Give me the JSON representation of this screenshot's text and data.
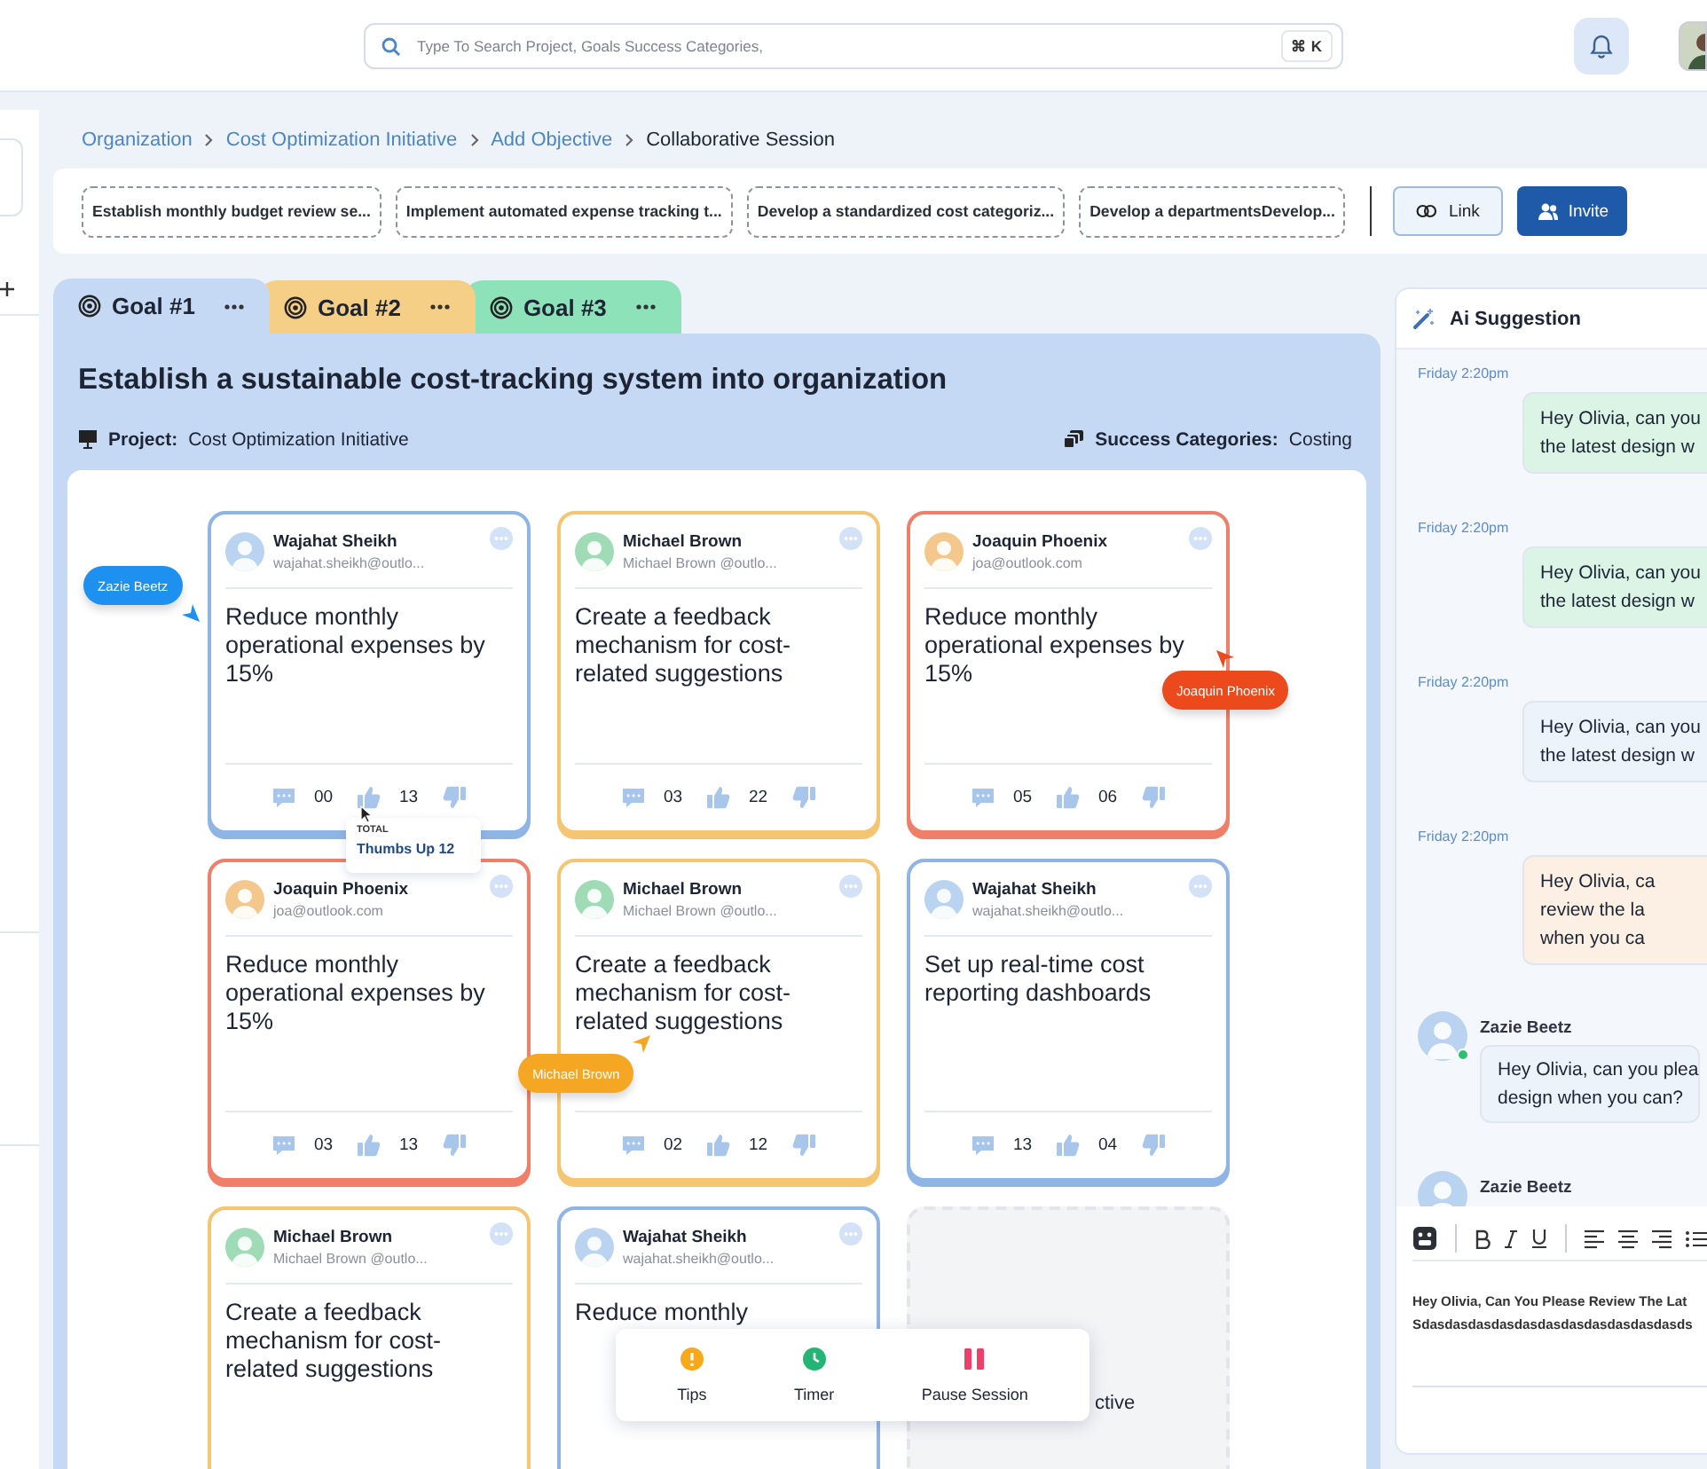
{
  "search": {
    "placeholder": "Type To Search Project, Goals Success Categories,",
    "shortcut": "⌘ K"
  },
  "breadcrumb": [
    {
      "label": "Organization",
      "current": false
    },
    {
      "label": "Cost Optimization Initiative",
      "current": false
    },
    {
      "label": "Add Objective",
      "current": false
    },
    {
      "label": "Collaborative Session",
      "current": true
    }
  ],
  "objective_chips": [
    "Establish monthly budget review se...",
    "Implement automated expense tracking t...",
    "Develop a standardized cost categoriz...",
    "Develop a  departmentsDevelop..."
  ],
  "actions": [
    {
      "label": "Link",
      "kind": "outline"
    },
    {
      "label": "Invite",
      "kind": "primary"
    }
  ],
  "goal_tabs": [
    {
      "label": "Goal #1",
      "color": "#c6d9f4",
      "selected": true
    },
    {
      "label": "Goal #2",
      "color": "#f6cf86",
      "selected": false
    },
    {
      "label": "Goal #3",
      "color": "#8ee2b9",
      "selected": false
    }
  ],
  "goal": {
    "title": "Establish a sustainable cost-tracking system into organization",
    "project_label": "Project:",
    "project": "Cost Optimization Initiative",
    "categories_label": "Success Categories:",
    "categories": "Costing"
  },
  "cards": [
    {
      "kind": "objective",
      "author": "Wajahat Sheikh",
      "email": "wajahat.sheikh@outlo...",
      "color": "#8fb5e6",
      "avatar": {
        "color": "#b9d3f0"
      },
      "text": "Reduce monthly operational expenses by 15%",
      "comments": "00",
      "likes": "13",
      "tooltip": {
        "title": "TOTAL",
        "text": "Thumbs Up 12"
      }
    },
    {
      "kind": "objective",
      "author": "Michael Brown",
      "email": "Michael Brown @outlo...",
      "color": "#f5c572",
      "avatar": {
        "color": "#9fdcb6"
      },
      "text": "Create a feedback mechanism for cost-related suggestions",
      "comments": "03",
      "likes": "22"
    },
    {
      "kind": "objective",
      "author": "Joaquin Phoenix",
      "email": "joa@outlook.com",
      "color": "#ef7f68",
      "avatar": {
        "color": "#f4c88c"
      },
      "text": "Reduce monthly operational expenses by 15%",
      "comments": "05",
      "likes": "06"
    },
    {
      "kind": "objective",
      "author": "Joaquin Phoenix",
      "email": "joa@outlook.com",
      "color": "#ef7f68",
      "avatar": {
        "color": "#f4c88c"
      },
      "text": "Reduce monthly operational expenses by 15%",
      "comments": "03",
      "likes": "13"
    },
    {
      "kind": "objective",
      "author": "Michael Brown",
      "email": "Michael Brown @outlo...",
      "color": "#f5c572",
      "avatar": {
        "color": "#9fdcb6"
      },
      "text": "Create a feedback mechanism for cost-related suggestions",
      "comments": "02",
      "likes": "12"
    },
    {
      "kind": "objective",
      "author": "Wajahat Sheikh",
      "email": "wajahat.sheikh@outlo...",
      "color": "#8fb5e6",
      "avatar": {
        "color": "#b9d3f0"
      },
      "text": "Set up real-time cost reporting dashboards",
      "comments": "13",
      "likes": "04"
    },
    {
      "kind": "objective",
      "author": "Michael Brown",
      "email": "Michael Brown @outlo...",
      "color": "#f5c572",
      "avatar": {
        "color": "#9fdcb6"
      },
      "text": "Create a feedback mechanism for cost-related suggestions"
    },
    {
      "kind": "objective",
      "author": "Wajahat Sheikh",
      "email": "wajahat.sheikh@outlo...",
      "color": "#8fb5e6",
      "avatar": {
        "color": "#b9d3f0"
      },
      "text": "Reduce monthly"
    },
    {
      "kind": "placeholder",
      "label": "ctive"
    }
  ],
  "cursors": [
    {
      "name": "Zazie Beetz",
      "color": "#1e90f0"
    },
    {
      "name": "Joaquin Phoenix",
      "color": "#ec4a1c"
    },
    {
      "name": "Michael Brown",
      "color": "#f5a623"
    }
  ],
  "session_toolbar": [
    {
      "label": "Tips",
      "kind": "tips"
    },
    {
      "label": "Timer",
      "kind": "timer"
    },
    {
      "label": "Pause Session",
      "kind": "pause"
    }
  ],
  "ai_panel": {
    "title": "Ai Suggestion",
    "messages": [
      {
        "kind": "outgoing",
        "time": "Friday 2:20pm",
        "color": "#dbf4e6",
        "lines": [
          "Hey Olivia, can you",
          "the latest design w"
        ]
      },
      {
        "kind": "outgoing",
        "time": "Friday 2:20pm",
        "color": "#dbf4e6",
        "lines": [
          "Hey Olivia, can you",
          "the latest design w"
        ]
      },
      {
        "kind": "outgoing",
        "time": "Friday 2:20pm",
        "color": "#edf3fb",
        "lines": [
          "Hey Olivia, can you",
          "the latest design w"
        ]
      },
      {
        "kind": "outgoing",
        "time": "Friday 2:20pm",
        "color": "#fbf0e3",
        "lines": [
          "Hey Olivia, ca",
          "review the la",
          "when you ca"
        ]
      },
      {
        "kind": "incoming",
        "author": "Zazie Beetz",
        "online": true,
        "lines": [
          "Hey Olivia, can you plea",
          "design when you can?"
        ]
      },
      {
        "kind": "incoming",
        "author": "Zazie Beetz"
      }
    ]
  },
  "editor": {
    "lines": [
      "Hey Olivia, Can You Please Review The Lat",
      "Sdasdasdasdasdasdasdasdasdasdasdasds"
    ]
  }
}
